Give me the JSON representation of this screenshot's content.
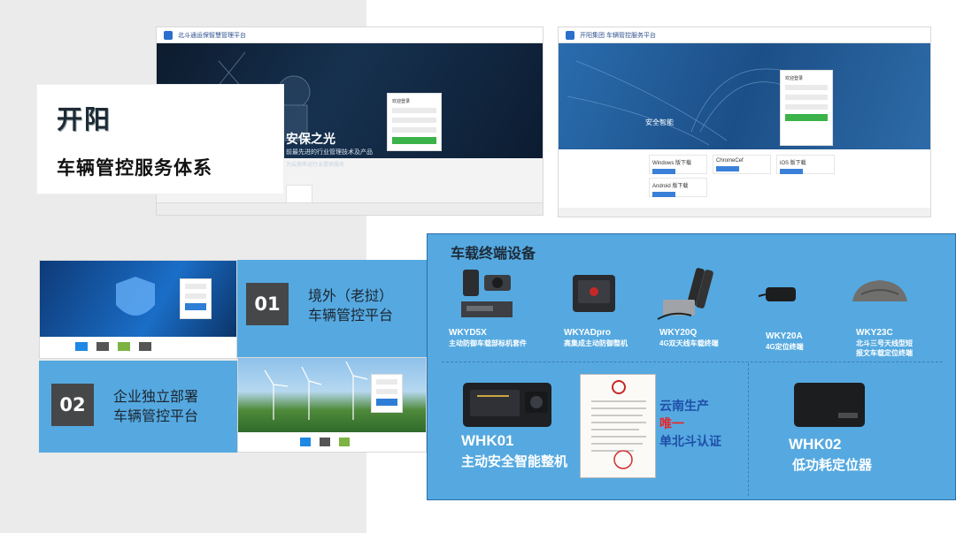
{
  "title_card": {
    "brand": "开阳",
    "subtitle": "车辆管控服务体系"
  },
  "screenshot_top_left": {
    "title": "北斗通运保智慧管理平台",
    "hero_heading": "安保之光",
    "hero_text_1": "前最先进的行业管理技术及产品",
    "hero_text_2": "为云南率运行业提供服务",
    "login_title": "欢迎登录",
    "login_button": "登录"
  },
  "screenshot_top_right": {
    "title": "开阳集团 车辆管控服务平台",
    "hero_heading": "安全智能",
    "login_title": "欢迎登录",
    "login_button": "登录",
    "downloads": [
      "Windows 版下载",
      "ChromeCef",
      "iOS 版下载",
      "Android 版下载"
    ]
  },
  "platforms": [
    {
      "number": "01",
      "line1": "境外（老挝）",
      "line2": "车辆管控平台"
    },
    {
      "number": "02",
      "line1": "企业独立部署",
      "line2": "车辆管控平台"
    }
  ],
  "devices": {
    "section_title": "车载终端设备",
    "items": [
      {
        "name": "WKYD5X",
        "desc1": "主动防御车载部标机套件",
        "desc2": ""
      },
      {
        "name": "WKYADpro",
        "desc1": "高集成主动防御整机",
        "desc2": ""
      },
      {
        "name": "WKY20Q",
        "desc1": "4G双天线车载终端",
        "desc2": ""
      },
      {
        "name": "WKY20A",
        "desc1": "4G定位终端",
        "desc2": ""
      },
      {
        "name": "WKY23C",
        "desc1": "北斗三号天线型短",
        "desc2": "报文车载定位终端"
      }
    ],
    "whk01": {
      "name": "WHK01",
      "desc": "主动安全智能整机"
    },
    "cert": {
      "line1": "云南生产",
      "line2": "唯一",
      "line3": "单北斗认证"
    },
    "whk02": {
      "name": "WHK02",
      "desc": "低功耗定位器"
    }
  },
  "colors": {
    "band_blue": "#55a9e0",
    "number_box": "#454749",
    "cert_red": "#e8262a",
    "cert_blue": "#1f4fa8"
  }
}
